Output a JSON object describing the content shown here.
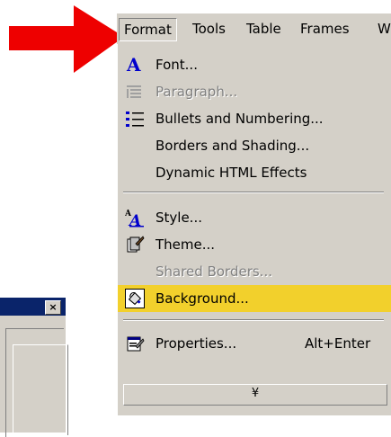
{
  "menubar": {
    "items": [
      {
        "label": "Format",
        "open": true
      },
      {
        "label": "Tools"
      },
      {
        "label": "Table"
      },
      {
        "label": "Frames"
      },
      {
        "label": "W"
      }
    ]
  },
  "format_menu": {
    "items": [
      {
        "label": "Font...",
        "icon": "font-icon",
        "enabled": true
      },
      {
        "label": "Paragraph...",
        "icon": "paragraph-icon",
        "enabled": false
      },
      {
        "label": "Bullets and Numbering...",
        "icon": "bullets-icon",
        "enabled": true
      },
      {
        "label": "Borders and Shading...",
        "enabled": true
      },
      {
        "label": "Dynamic HTML Effects",
        "enabled": true
      },
      {
        "label": "Style...",
        "icon": "style-icon",
        "enabled": true
      },
      {
        "label": "Theme...",
        "icon": "theme-icon",
        "enabled": true
      },
      {
        "label": "Shared Borders...",
        "enabled": false
      },
      {
        "label": "Background...",
        "icon": "background-icon",
        "enabled": true,
        "highlighted": true
      },
      {
        "label": "Properties...",
        "icon": "properties-icon",
        "shortcut": "Alt+Enter",
        "enabled": true
      }
    ],
    "expand_glyph": "¥"
  },
  "dialog": {
    "close_glyph": "×"
  },
  "colors": {
    "menu_bg": "#d4d0c8",
    "highlight": "#f2d02c",
    "arrow": "#ee0000",
    "disabled_text": "#808080",
    "icon_blue": "#0000cc"
  }
}
